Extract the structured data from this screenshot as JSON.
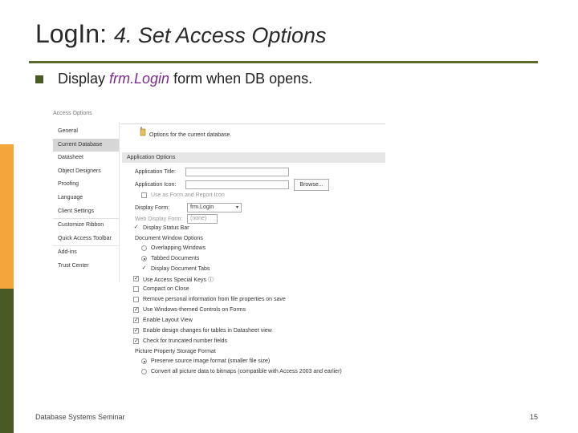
{
  "slide": {
    "title_main": "LogIn:",
    "title_em": "4. Set Access Options",
    "bullet_pre": "Display ",
    "bullet_code": "frm.Login",
    "bullet_post": " form when DB opens.",
    "footer_left": "Database Systems Seminar",
    "page_number": "15"
  },
  "dialog": {
    "title": "Access Options",
    "nav": [
      "General",
      "Current Database",
      "Datasheet",
      "Object Designers",
      "Proofing",
      "Language",
      "Client Settings",
      "Customize Ribbon",
      "Quick Access Toolbar",
      "Add-ins",
      "Trust Center"
    ],
    "header_text": "Options for the current database.",
    "section_title": "Application Options",
    "app_title_label": "Application Title:",
    "app_title_value": "",
    "app_icon_label": "Application Icon:",
    "app_icon_value": "",
    "browse_label": "Browse...",
    "use_as_icon_label": "Use as Form and Report Icon",
    "display_form_label": "Display Form:",
    "display_form_value": "frm.Login",
    "web_display_label": "Web Display Form:",
    "web_display_value": "(none)",
    "status_bar_label": "Display Status Bar",
    "doc_window_label": "Document Window Options",
    "overlapping_label": "Overlapping Windows",
    "tabbed_label": "Tabbed Documents",
    "doc_tabs_label": "Display Document Tabs",
    "special_keys_label": "Use Access Special Keys",
    "compact_label": "Compact on Close",
    "remove_info_label": "Remove personal information from file properties on save",
    "themed_controls_label": "Use Windows-themed Controls on Forms",
    "layout_view_label": "Enable Layout View",
    "design_changes_label": "Enable design changes for tables in Datasheet view",
    "truncated_label": "Check for truncated number fields",
    "picture_format_label": "Picture Property Storage Format",
    "preserve_label": "Preserve source image format (smaller file size)",
    "convert_label": "Convert all picture data to bitmaps (compatible with Access 2003 and earlier)",
    "info_icon": "ⓘ",
    "check_mark": "✓",
    "dropdown_arrow": "▾"
  }
}
